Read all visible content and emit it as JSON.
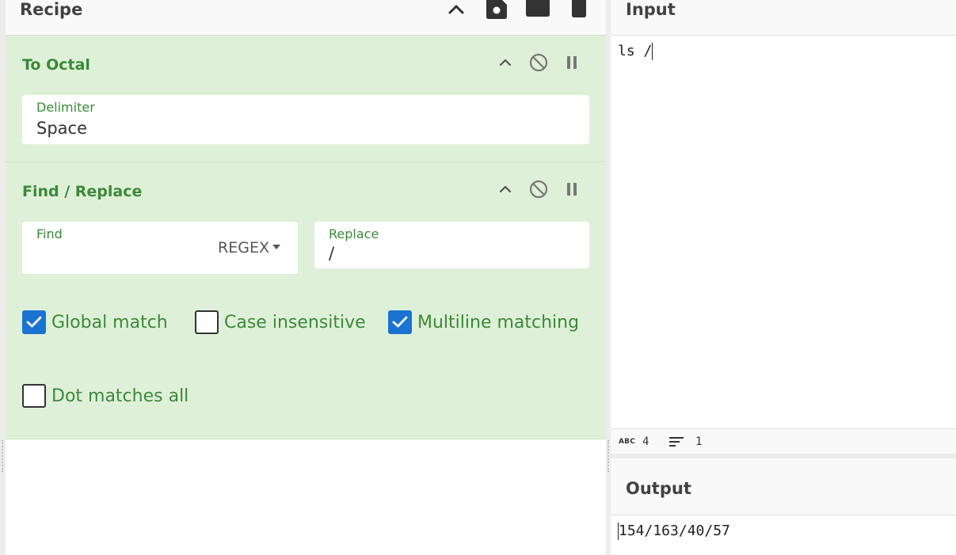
{
  "recipe": {
    "title": "Recipe",
    "icons": [
      "chevron-up-icon",
      "save-icon",
      "folder-icon",
      "trash-icon"
    ]
  },
  "operations": [
    {
      "title": "To Octal",
      "fields": [
        {
          "label": "Delimiter",
          "value": "Space"
        }
      ]
    },
    {
      "title": "Find / Replace",
      "find": {
        "label": "Find",
        "value": "",
        "mode": "REGEX"
      },
      "replace": {
        "label": "Replace",
        "value": "/"
      },
      "options": [
        {
          "label": "Global match",
          "checked": true
        },
        {
          "label": "Case insensitive",
          "checked": false
        },
        {
          "label": "Multiline matching",
          "checked": true
        },
        {
          "label": "Dot matches all",
          "checked": false
        }
      ]
    }
  ],
  "input": {
    "title": "Input",
    "text": "ls /",
    "status": {
      "length": "4",
      "lines": "1"
    }
  },
  "output": {
    "title": "Output",
    "text": "154/163/40/57"
  },
  "colors": {
    "op_background": "#dff0d8",
    "op_text": "#3a8a38",
    "checkbox_on": "#1a73d0"
  }
}
